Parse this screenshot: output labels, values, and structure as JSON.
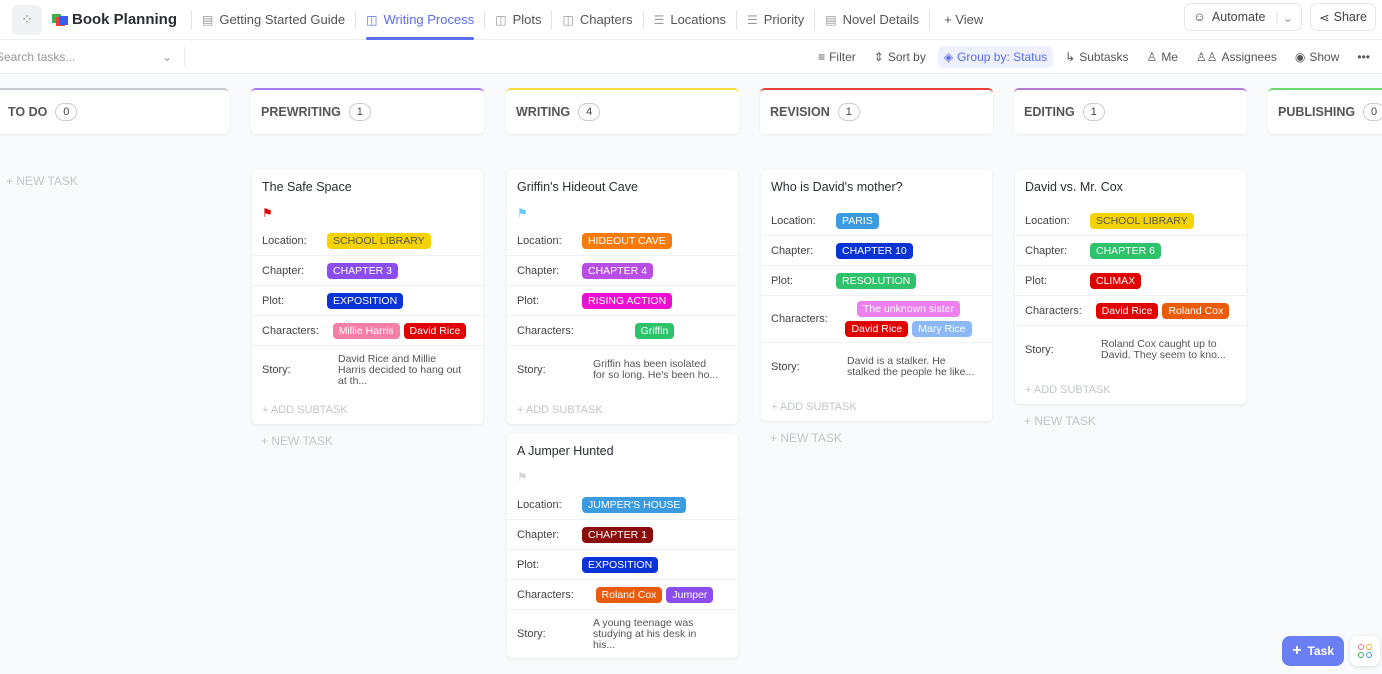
{
  "app": {
    "space_title": "Book Planning"
  },
  "tabs": [
    {
      "label": "Getting Started Guide",
      "icon": "doc-icon",
      "active": false
    },
    {
      "label": "Writing Process",
      "icon": "board-icon",
      "active": true
    },
    {
      "label": "Plots",
      "icon": "board-icon",
      "active": false
    },
    {
      "label": "Chapters",
      "icon": "board-icon",
      "active": false
    },
    {
      "label": "Locations",
      "icon": "list-icon",
      "active": false
    },
    {
      "label": "Priority",
      "icon": "list-icon",
      "active": false
    },
    {
      "label": "Novel Details",
      "icon": "doc-icon",
      "active": false
    }
  ],
  "add_view": "+ View",
  "automate": "Automate",
  "share": "Share",
  "search": {
    "placeholder": "Search tasks..."
  },
  "toolbar": {
    "filter": "Filter",
    "sort": "Sort by",
    "group": "Group by: Status",
    "subtasks": "Subtasks",
    "me": "Me",
    "assignees": "Assignees",
    "show": "Show"
  },
  "columns": [
    {
      "name": "TO DO",
      "count": "0",
      "color": "#c9ccd1"
    },
    {
      "name": "PREWRITING",
      "count": "1",
      "color": "#a77cf2"
    },
    {
      "name": "WRITING",
      "count": "4",
      "color": "#f5dc3b"
    },
    {
      "name": "REVISION",
      "count": "1",
      "color": "#e8443a"
    },
    {
      "name": "EDITING",
      "count": "1",
      "color": "#b57ad6"
    },
    {
      "name": "PUBLISHING",
      "count": "0",
      "color": "#6ad86a"
    }
  ],
  "labels": {
    "location": "Location:",
    "chapter": "Chapter:",
    "plot": "Plot:",
    "characters": "Characters:",
    "story": "Story:",
    "add_subtask": "+ ADD SUBTASK",
    "new_task": "+ NEW TASK"
  },
  "cards": {
    "safe_space": {
      "title": "The Safe Space",
      "flag_color": "#e60000",
      "location": {
        "text": "SCHOOL LIBRARY",
        "color": "#f5d300",
        "fg": "#555"
      },
      "chapter": {
        "text": "CHAPTER 3",
        "color": "#8b4cf0"
      },
      "plot": {
        "text": "EXPOSITION",
        "color": "#0a33d6"
      },
      "characters": [
        {
          "text": "Millie Harris",
          "color": "#f77fa7"
        },
        {
          "text": "David Rice",
          "color": "#e00000"
        }
      ],
      "story": "David Rice and Millie Harris decided to hang out at th..."
    },
    "griffin": {
      "title": "Griffin's Hideout Cave",
      "flag_color": "#6cc7f5",
      "location": {
        "text": "HIDEOUT CAVE",
        "color": "#f77b0c"
      },
      "chapter": {
        "text": "CHAPTER 4",
        "color": "#b84ee3"
      },
      "plot": {
        "text": "RISING ACTION",
        "color": "#ee0ed1"
      },
      "characters": [
        {
          "text": "Griffin",
          "color": "#2ec26b"
        }
      ],
      "story": "Griffin has been isolated for so long. He's been ho..."
    },
    "jumper": {
      "title": "A Jumper Hunted",
      "flag_color": "#d8d8d8",
      "location": {
        "text": "JUMPER'S HOUSE",
        "color": "#3b9be0"
      },
      "chapter": {
        "text": "CHAPTER 1",
        "color": "#8b0a0a"
      },
      "plot": {
        "text": "EXPOSITION",
        "color": "#0a33d6"
      },
      "characters": [
        {
          "text": "Roland Cox",
          "color": "#eb5b0c"
        },
        {
          "text": "Jumper",
          "color": "#8b4cf0"
        }
      ],
      "story": "A young teenage was studying at his desk in his..."
    },
    "mother": {
      "title": "Who is David's mother?",
      "location": {
        "text": "PARIS",
        "color": "#3b9be0"
      },
      "chapter": {
        "text": "CHAPTER 10",
        "color": "#0a33d6"
      },
      "plot": {
        "text": "RESOLUTION",
        "color": "#2ec26b"
      },
      "characters": [
        {
          "text": "The unknown sister",
          "color": "#ee7fee"
        },
        {
          "text": "David Rice",
          "color": "#e00000"
        },
        {
          "text": "Mary Rice",
          "color": "#8db8f7"
        }
      ],
      "story": "David is a stalker. He stalked the people he like..."
    },
    "cox": {
      "title": "David vs. Mr. Cox",
      "location": {
        "text": "SCHOOL LIBRARY",
        "color": "#f5d300",
        "fg": "#555"
      },
      "chapter": {
        "text": "CHAPTER 6",
        "color": "#2ec26b"
      },
      "plot": {
        "text": "CLIMAX",
        "color": "#e00000"
      },
      "characters": [
        {
          "text": "David Rice",
          "color": "#e00000"
        },
        {
          "text": "Roland Cox",
          "color": "#eb5b0c"
        }
      ],
      "story": "Roland Cox caught up to David. They seem to kno..."
    }
  },
  "fab": {
    "label": "Task"
  }
}
